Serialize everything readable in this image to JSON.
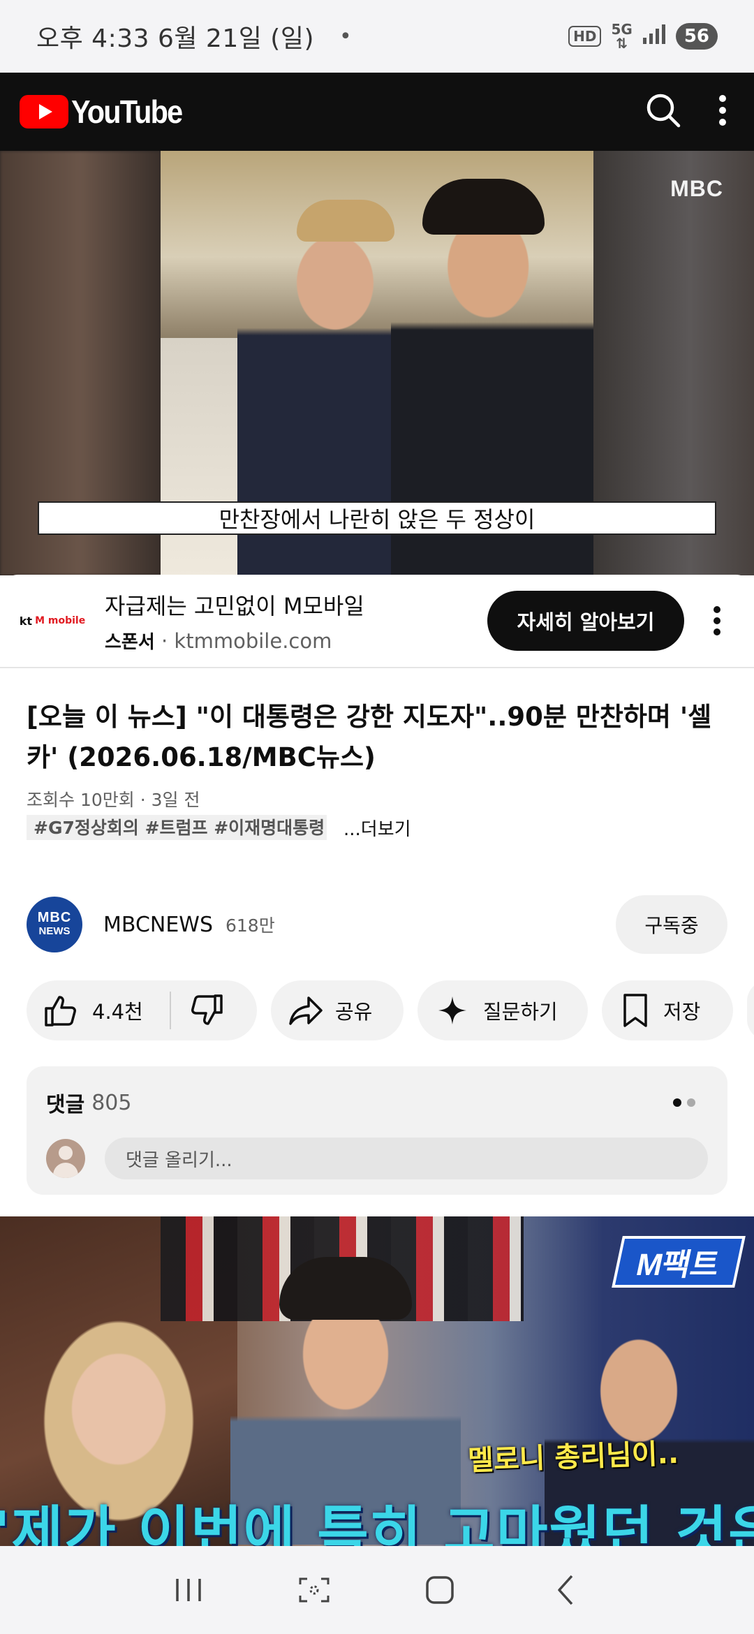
{
  "status_bar": {
    "time": "오후 4:33  6월 21일 (일)",
    "dot": "•",
    "hd": "HD",
    "net": "5G",
    "battery": "56"
  },
  "header": {
    "logo_text": "YouTube",
    "icons": [
      "search-icon",
      "more-vert-icon"
    ]
  },
  "video": {
    "watermark": "MBC",
    "subtitle": "만찬장에서 나란히 앉은 두 정상이"
  },
  "ad": {
    "logo_kt": "kt",
    "logo_m": "M mobile",
    "title": "자급제는 고민없이 M모바일",
    "sponsor_label": "스폰서",
    "separator": " · ",
    "domain": "ktmmobile.com",
    "cta": "자세히 알아보기"
  },
  "title": "[오늘 이 뉴스] \"이 대통령은 강한 지도자\"..90분 만찬하며 '셀카' (2026.06.18/MBC뉴스)",
  "meta": "조회수 10만회 · 3일 전",
  "hashtags": "#G7정상회의 #트럼프 #이재명대통령",
  "more_label": "...더보기",
  "channel": {
    "avatar_line1": "MBC",
    "avatar_line2": "NEWS",
    "name": "MBCNEWS",
    "subscribers": "618만",
    "subscribe_label": "구독중"
  },
  "actions": {
    "like_count": "4.4천",
    "share": "공유",
    "ask": "질문하기",
    "save": "저장"
  },
  "comments": {
    "label": "댓글",
    "count": "805",
    "placeholder": "댓글 올리기..."
  },
  "next_video": {
    "badge": "M팩트",
    "caption": "멜로니 총리님이..",
    "big_text": "'제가 이번에 특히 고마웠던 것은'"
  },
  "colors": {
    "youtube_red": "#ff0000",
    "header_bg": "#0f0f0f",
    "cta_bg": "#0f0f0f",
    "pill_bg": "#f2f2f2"
  }
}
